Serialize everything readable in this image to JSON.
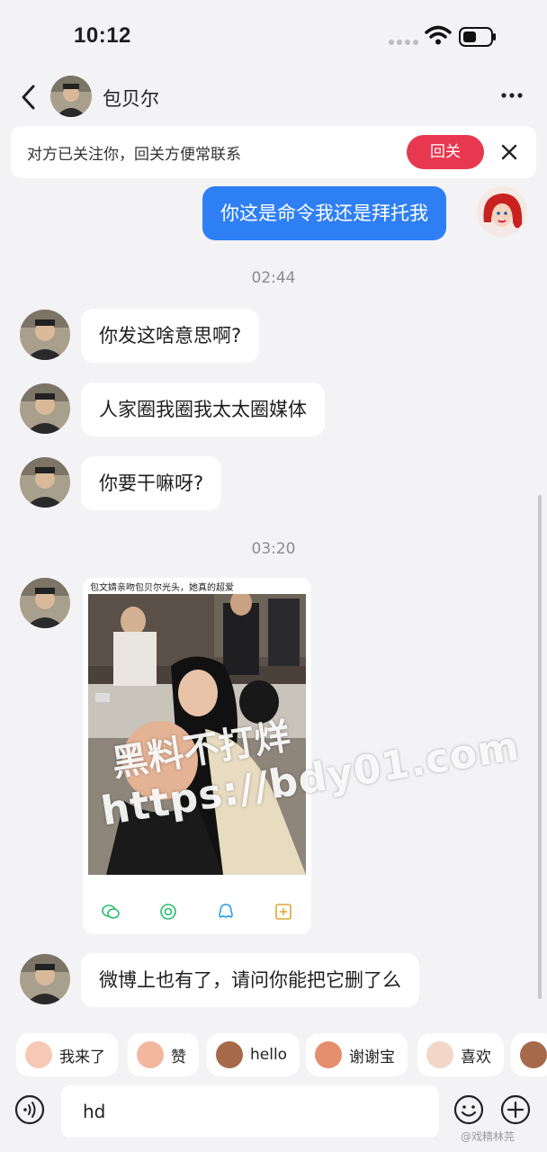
{
  "status_bar": {
    "time": "10:12"
  },
  "nav": {
    "contact_name": "包贝尔"
  },
  "follow_banner": {
    "text": "对方已关注你，回关方便常联系",
    "button_label": "回关"
  },
  "messages": {
    "m1": "你这是命令我还是拜托我",
    "t1": "02:44",
    "m2": "你发这啥意思啊?",
    "m3": "人家圈我圈我太太圈媒体",
    "m4": "你要干嘛呀?",
    "t2": "03:20",
    "image_caption": "包文婧亲吻包贝尔光头，她真的超爱",
    "m5": "微博上也有了，请问你能把它删了么"
  },
  "watermark": {
    "line1": "黑料不打烊",
    "line2": "https://bdy01.com"
  },
  "quick_replies": [
    "我来了",
    "赞",
    "hello",
    "谢谢宝",
    "喜欢"
  ],
  "input": {
    "value": "hd"
  },
  "footer_mark": "@戏精林芫",
  "colors": {
    "background": "#f3f3f5",
    "outgoing_bubble": "#2f7ff4",
    "follow_button": "#e8384f"
  }
}
